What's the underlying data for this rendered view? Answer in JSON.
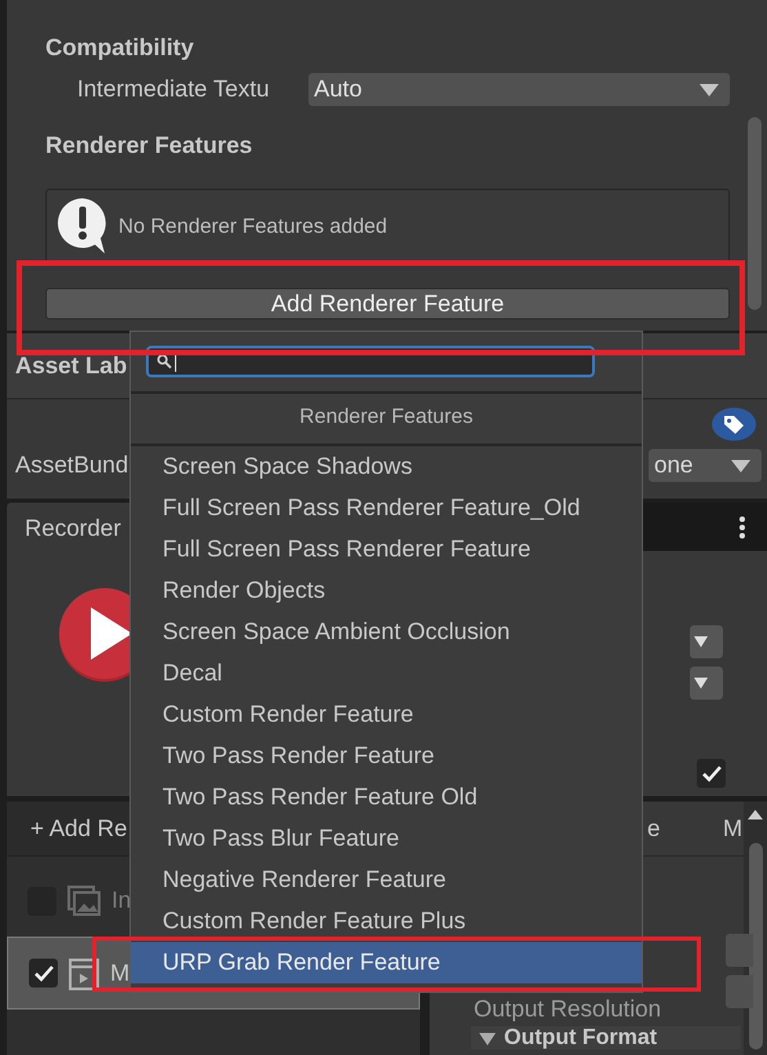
{
  "inspector": {
    "compatibility_heading": "Compatibility",
    "intermediate_texture": {
      "label": "Intermediate Textu",
      "value": "Auto"
    },
    "renderer_features_heading": "Renderer Features",
    "help_message": "No Renderer Features added",
    "add_button": "Add Renderer Feature",
    "add_button_highlighted": true
  },
  "asset_labels": {
    "title": "Asset Lab",
    "assetbundle_label": "AssetBund",
    "assetbundle_value": "one"
  },
  "recorder": {
    "tab": "Recorder",
    "option_checked": true,
    "add_button": "+ Add Re",
    "recorders": [
      {
        "name": "In",
        "kind": "image",
        "enabled": false,
        "selected": false
      },
      {
        "name": "M",
        "kind": "movie",
        "enabled": true,
        "selected": true
      }
    ],
    "column_1": "e",
    "column_2": "M",
    "output_resolution_label": "Output Resolution",
    "output_format": {
      "label": "Output Format",
      "expanded": true
    }
  },
  "dropdown": {
    "header": "Renderer Features",
    "items": [
      {
        "label": "Screen Space Shadows",
        "selected": false,
        "highlighted": false
      },
      {
        "label": "Full Screen Pass Renderer Feature_Old",
        "selected": false,
        "highlighted": false
      },
      {
        "label": "Full Screen Pass Renderer Feature",
        "selected": false,
        "highlighted": false
      },
      {
        "label": "Render Objects",
        "selected": false,
        "highlighted": false
      },
      {
        "label": "Screen Space Ambient Occlusion",
        "selected": false,
        "highlighted": false
      },
      {
        "label": "Decal",
        "selected": false,
        "highlighted": false
      },
      {
        "label": "Custom Render Feature",
        "selected": false,
        "highlighted": false
      },
      {
        "label": "Two Pass Render Feature",
        "selected": false,
        "highlighted": false
      },
      {
        "label": "Two Pass Render Feature Old",
        "selected": false,
        "highlighted": false
      },
      {
        "label": "Two Pass Blur Feature",
        "selected": false,
        "highlighted": false
      },
      {
        "label": "Negative Renderer Feature",
        "selected": false,
        "highlighted": false
      },
      {
        "label": "Custom Render Feature Plus",
        "selected": false,
        "highlighted": false
      },
      {
        "label": "URP Grab Render Feature",
        "selected": true,
        "highlighted": true
      }
    ]
  }
}
